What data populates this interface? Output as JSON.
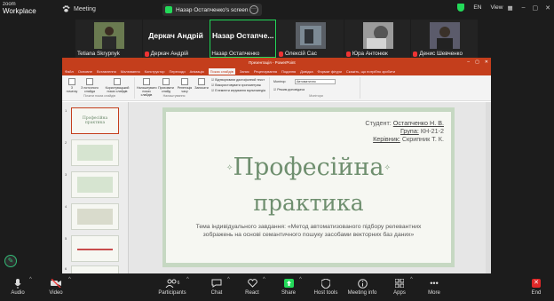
{
  "app": {
    "brand_top": "zoom",
    "brand_bottom": "Workplace",
    "meeting_label": "Meeting"
  },
  "share_banner": {
    "text": "Назар Остапченко's screen"
  },
  "top_right": {
    "lang": "EN",
    "view_label": "View"
  },
  "participants": [
    {
      "name": "Tetiana Skrypnyk",
      "video": true,
      "muted": false
    },
    {
      "name": "Деркач Андрій",
      "display_big": "Деркач Андрій",
      "muted": true
    },
    {
      "name": "Назар Остапченко",
      "display_big": "Назар Остапче...",
      "muted": false,
      "active": true
    },
    {
      "name": "Олексій Сас",
      "video": true,
      "muted": true
    },
    {
      "name": "Юра Антонюк",
      "video": true,
      "muted": true
    },
    {
      "name": "Денис Шевченко",
      "video": true,
      "muted": true
    }
  ],
  "ppt": {
    "window_title": "Презентація - PowerPoint",
    "tabs": [
      "Файл",
      "Основне",
      "Вставлення",
      "Малювання",
      "Конструктор",
      "Переходи",
      "Анімація",
      "Показ слайдів",
      "Запис",
      "Рецензування",
      "Подання",
      "Довідка",
      "Формат фігури"
    ],
    "selected_tab": "Показ слайдів",
    "search_hint": "Скажіть, що потрібно зробити",
    "ribbon": {
      "start_group": "Почати показ слайдів",
      "btn_from_start": "З початку",
      "btn_from_current": "З поточного слайда",
      "btn_custom": "Користувацький показ слайдів",
      "setup_group": "Налаштування",
      "btn_setup": "Налаштувати показ слайдів",
      "btn_hide": "Приховати слайд",
      "btn_rehearse": "Репетиція часу",
      "btn_record": "Записати",
      "chk1": "Відтворювати диктофонний текст",
      "chk2": "Використовувати хронометраж",
      "chk3": "Елементи керування мультимедіа",
      "monitor_group": "Монітори",
      "monitor_label": "Монітор:",
      "monitor_value": "Автоматично",
      "presenter_view": "Режим доповідача"
    },
    "slide_numbers": [
      "1",
      "2",
      "3",
      "4",
      "5",
      "6"
    ],
    "thumb_titles": [
      "Професійна практика",
      "",
      "",
      "",
      "",
      ""
    ]
  },
  "slide": {
    "student_label": "Студент:",
    "student_name": "Остапченко Н. В.",
    "group_label": "Група:",
    "group_value": "КН-21-2",
    "supervisor_label": "Керівник:",
    "supervisor_value": "Скрипник Т. К.",
    "title_line1": "Професійна",
    "title_line2": "практика",
    "task_line1": "Тема індивідуального завдання: «Метод автоматизованого підбору релевантних",
    "task_line2": "зображень на основі семантичного пошуку засобами векторних баз даних»"
  },
  "toolbar": {
    "audio": "Audio",
    "video": "Video",
    "participants": "Participants",
    "participants_count": "6",
    "chat": "Chat",
    "react": "React",
    "share": "Share",
    "host_tools": "Host tools",
    "meeting_info": "Meeting info",
    "apps": "Apps",
    "more": "More",
    "end": "End"
  },
  "colors": {
    "accent_green": "#23d959",
    "ppt_red": "#c43e1c",
    "slide_green": "#6f8f6f",
    "end_red": "#e02828"
  }
}
